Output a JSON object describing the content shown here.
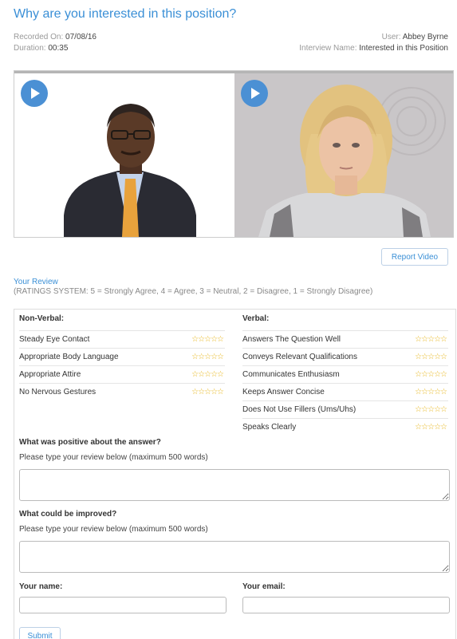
{
  "header": {
    "title": "Why are you interested in this position?",
    "recorded_label": "Recorded On:",
    "recorded_value": "07/08/16",
    "duration_label": "Duration:",
    "duration_value": "00:35",
    "user_label": "User:",
    "user_value": "Abbey Byrne",
    "interview_label": "Interview Name:",
    "interview_value": "Interested in this Position"
  },
  "video": {
    "play_icon": "play-icon"
  },
  "report_button": "Report Video",
  "review": {
    "title": "Your Review",
    "rating_system": "(RATINGS SYSTEM: 5 = Strongly Agree, 4 = Agree, 3 = Neutral, 2 = Disagree, 1 = Strongly Disagree)",
    "star_symbol": "☆☆☆☆☆",
    "nonverbal_heading": "Non-Verbal:",
    "verbal_heading": "Verbal:",
    "nonverbal": [
      "Steady Eye Contact",
      "Appropriate Body Language",
      "Appropriate Attire",
      "No Nervous Gestures"
    ],
    "verbal": [
      "Answers The Question Well",
      "Conveys Relevant Qualifications",
      "Communicates Enthusiasm",
      "Keeps Answer Concise",
      "Does Not Use Fillers (Ums/Uhs)",
      "Speaks Clearly"
    ],
    "positive_question": "What was positive about the answer?",
    "positive_hint": "Please type your review below (maximum 500 words)",
    "improve_question": "What could be improved?",
    "improve_hint": "Please type your review below (maximum 500 words)",
    "name_label": "Your name:",
    "email_label": "Your email:",
    "submit_label": "Submit"
  },
  "colors": {
    "accent": "#3a8fd6",
    "play_button": "#4b90d4",
    "star": "#e7b416"
  }
}
